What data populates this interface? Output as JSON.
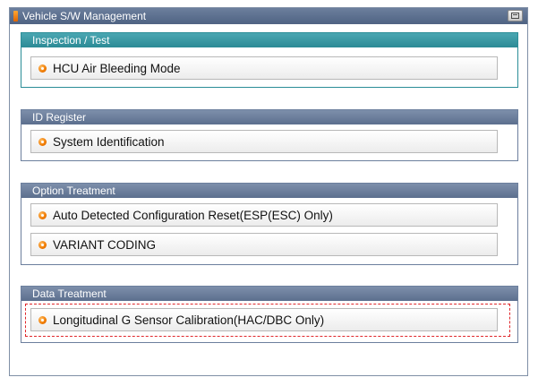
{
  "window": {
    "title": "Vehicle S/W Management",
    "icons": {
      "title": "app-icon",
      "button": "restore-icon"
    },
    "colors": {
      "titlebar": "#5c6f8e",
      "accent_teal": "#2a8d97",
      "bullet": "#f07a00",
      "selection": "#e0262a"
    }
  },
  "groups": [
    {
      "title": "Inspection / Test",
      "items": [
        {
          "label": "HCU Air Bleeding Mode"
        }
      ]
    },
    {
      "title": "ID Register",
      "items": [
        {
          "label": "System Identification"
        }
      ]
    },
    {
      "title": "Option Treatment",
      "items": [
        {
          "label": "Auto Detected Configuration Reset(ESP(ESC) Only)"
        },
        {
          "label": "VARIANT CODING"
        }
      ]
    },
    {
      "title": "Data Treatment",
      "items": [
        {
          "label": "Longitudinal G Sensor Calibration(HAC/DBC Only)"
        }
      ]
    }
  ]
}
